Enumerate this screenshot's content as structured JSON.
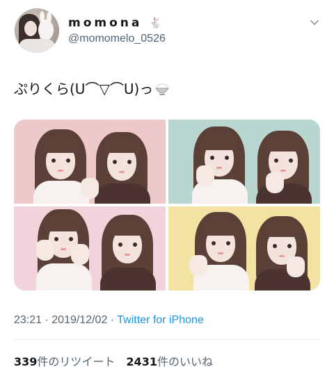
{
  "user": {
    "display_name": "momona",
    "display_emoji": "🐇",
    "handle": "@momomelo_0526",
    "avatar": "profile-photo"
  },
  "tweet": {
    "text": "ぷりくら(U⌒▽⌒U)っ",
    "emoji": "rice-bowl-icon",
    "photos": [
      {
        "description_bg": "#edc9c9"
      },
      {
        "description_bg": "#b9d6d1"
      },
      {
        "description_bg": "#f1d3db"
      },
      {
        "description_bg": "#f2e3a3"
      }
    ]
  },
  "meta": {
    "time": "23:21",
    "separator1": " · ",
    "date": "2019/12/02",
    "separator2": " · ",
    "source": "Twitter for iPhone"
  },
  "stats": {
    "retweets_count": "339",
    "retweets_label": "件のリツイート",
    "likes_count": "2431",
    "likes_label": "件のいいね"
  },
  "icons": {
    "menu": "chevron-down-icon",
    "emoji_in_name": "rabbit-icon"
  },
  "colors": {
    "link": "#1b95e0",
    "secondary_text": "#536471",
    "primary_text": "#14171a"
  }
}
